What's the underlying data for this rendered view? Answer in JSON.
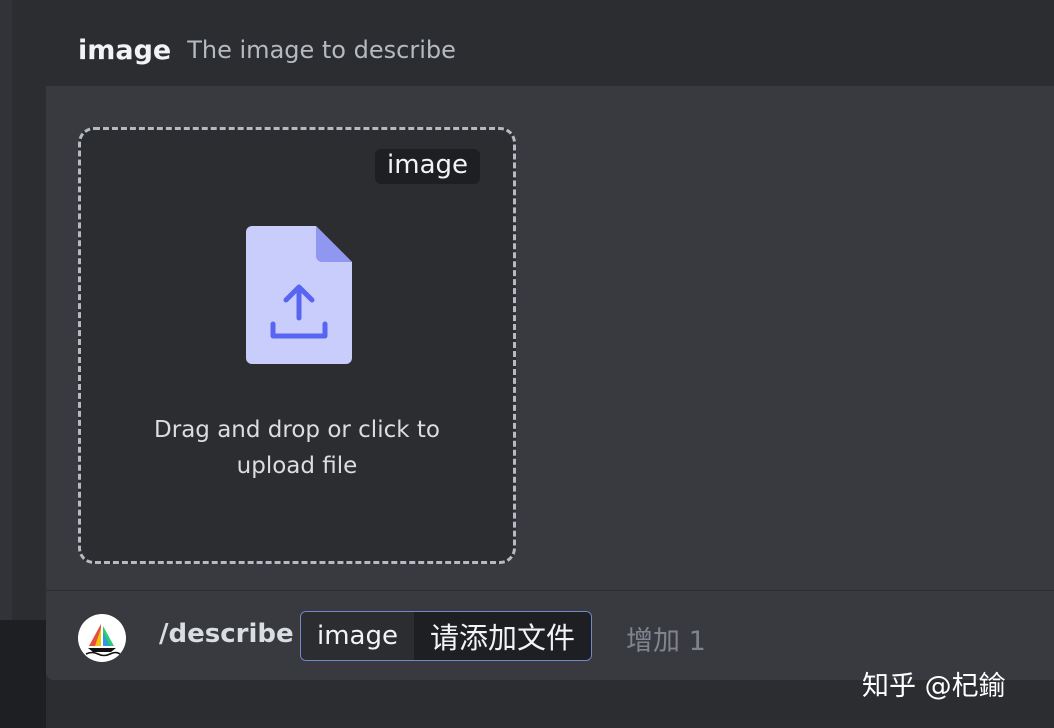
{
  "option": {
    "name": "image",
    "description": "The image to describe"
  },
  "dropzone": {
    "tag": "image",
    "text": "Drag and drop or click to upload file",
    "icon": "file-upload-icon",
    "icon_color": "#5865f2",
    "icon_bg": "#c9cdfb"
  },
  "command": {
    "avatar": "midjourney-boat-icon",
    "name": "/describe",
    "param_name": "image",
    "param_value": "请添加文件",
    "extra": "增加 1"
  },
  "watermark": "知乎 @杞鍮"
}
